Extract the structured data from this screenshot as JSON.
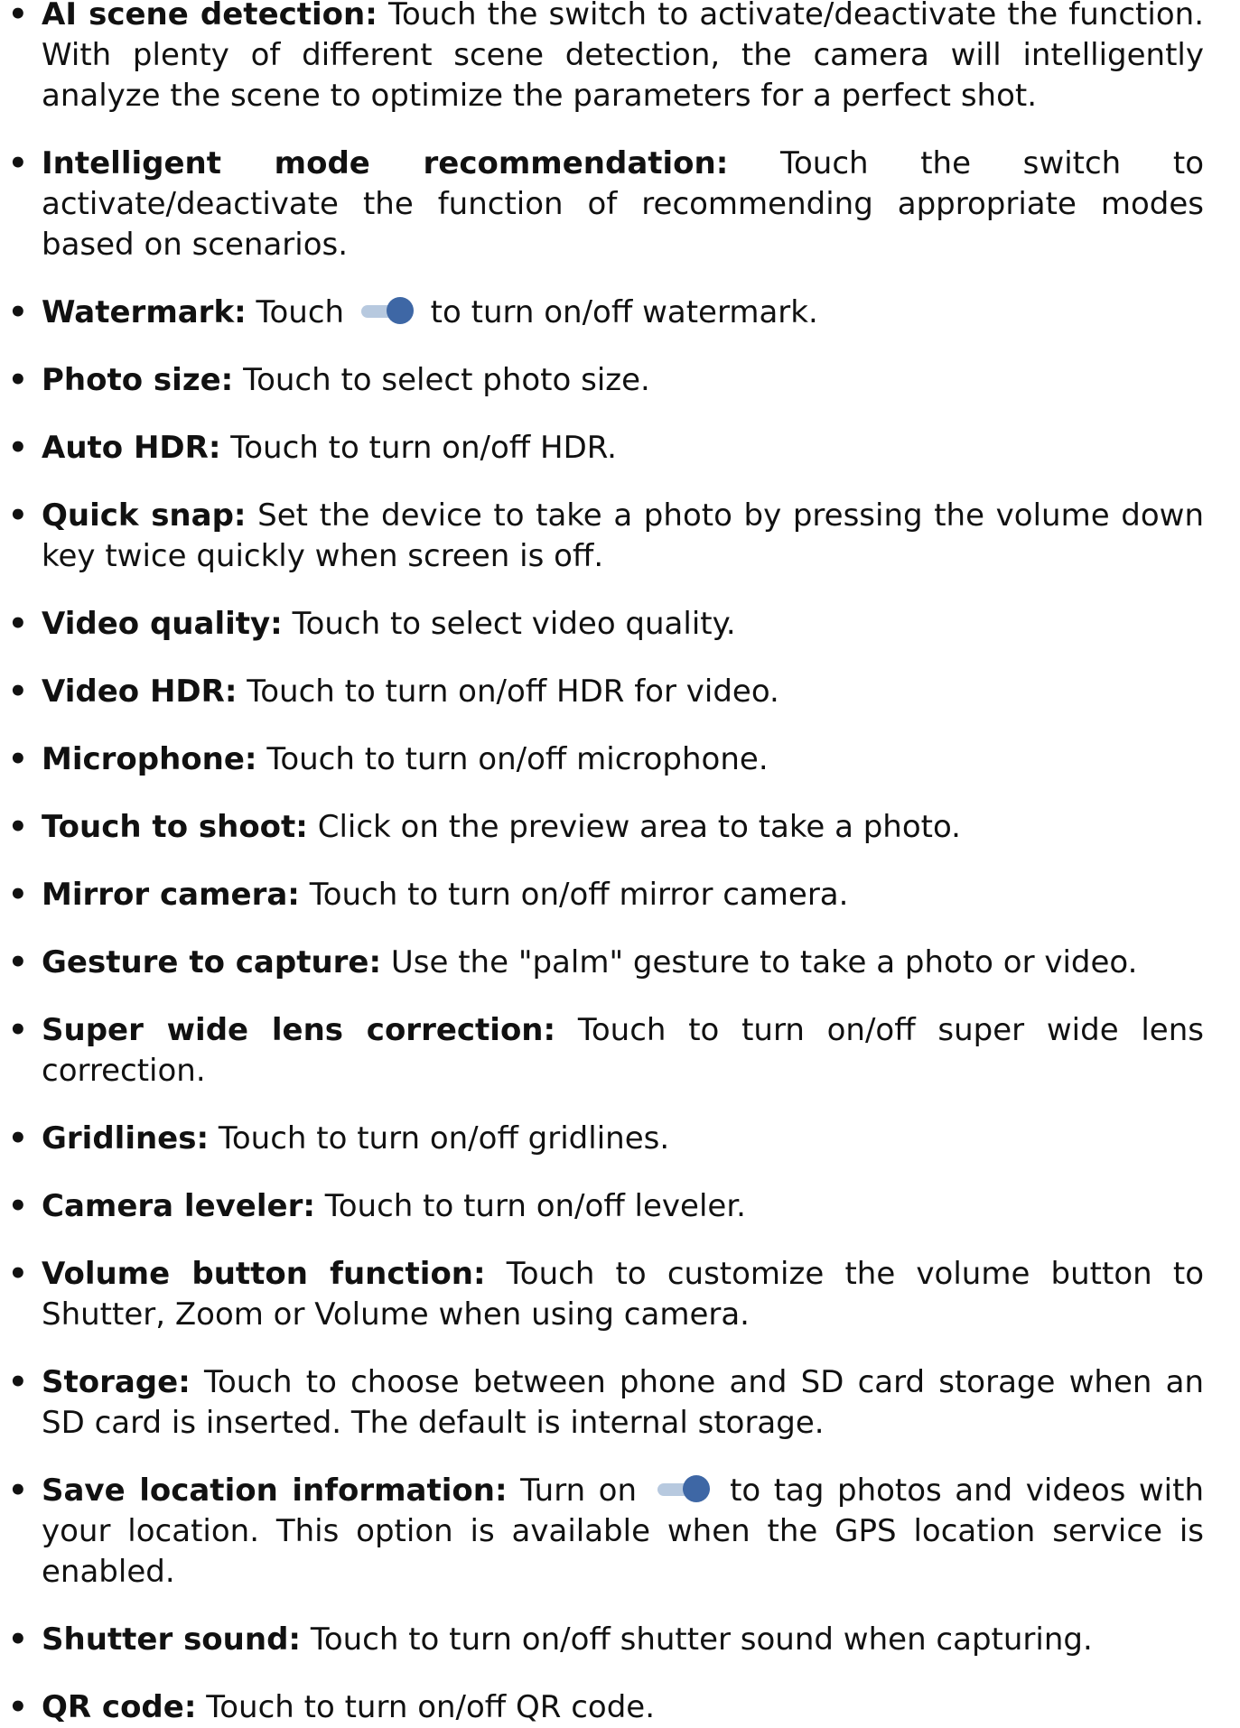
{
  "items": [
    {
      "term": "AI scene detection:",
      "text": " Touch the switch to activate/deactivate the function. With plenty of different scene detection, the camera will intelligently analyze the scene to optimize the parameters for a perfect shot."
    },
    {
      "term": "Intelligent mode recommendation:",
      "text": " Touch the switch to activate/deactivate the function of recommending appropriate modes based on scenarios."
    },
    {
      "term": "Watermark:",
      "pre": " Touch ",
      "icon": "toggle-on-icon",
      "post": " to turn on/off watermark."
    },
    {
      "term": "Photo size:",
      "text": " Touch to select photo size."
    },
    {
      "term": "Auto HDR:",
      "text": " Touch to turn on/off HDR."
    },
    {
      "term": "Quick snap:",
      "text": " Set the device to take a photo by pressing the volume down key twice quickly when screen is off."
    },
    {
      "term": "Video quality:",
      "text": " Touch to select video quality."
    },
    {
      "term": "Video HDR:",
      "text": " Touch to turn on/off HDR for video."
    },
    {
      "term": "Microphone:",
      "text": " Touch to turn on/off microphone."
    },
    {
      "term": "Touch to shoot:",
      "text": " Click on the preview area to take a photo."
    },
    {
      "term": "Mirror camera:",
      "text": " Touch to turn on/off mirror camera."
    },
    {
      "term": "Gesture to capture:",
      "text": " Use the \"palm\" gesture to take a photo or video."
    },
    {
      "term": "Super wide lens correction:",
      "text": " Touch to turn on/off super wide lens correction."
    },
    {
      "term": "Gridlines:",
      "text": " Touch to turn on/off gridlines."
    },
    {
      "term": "Camera leveler:",
      "text": " Touch to turn on/off leveler."
    },
    {
      "term": "Volume button function:",
      "text": " Touch to customize the volume button to Shutter, Zoom or Volume when using camera."
    },
    {
      "term": "Storage:",
      "text": " Touch to choose between phone and SD card storage when an SD card is inserted. The default is internal storage."
    },
    {
      "term": "Save location information:",
      "pre": " Turn on ",
      "icon": "toggle-on-icon",
      "post": " to tag photos and videos with your location. This option is available when the GPS location service is enabled."
    },
    {
      "term": "Shutter sound:",
      "text": " Touch to turn on/off shutter sound when capturing."
    },
    {
      "term": "QR code:",
      "text": " Touch to turn on/off QR code."
    }
  ],
  "bullet": "•",
  "colors": {
    "text": "#111111",
    "toggle_track": "#b7c9df",
    "toggle_knob": "#3e67a5"
  }
}
